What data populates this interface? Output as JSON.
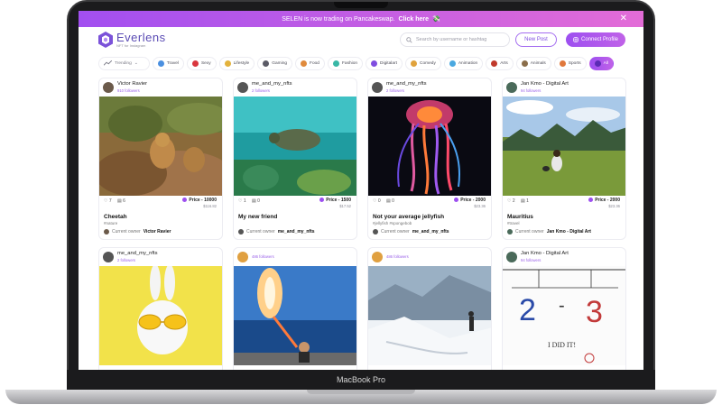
{
  "banner": {
    "text": "SELEN is now trading on Pancakeswap.",
    "link": "Click here",
    "emoji": "💸",
    "close_icon": "close-icon"
  },
  "brand": {
    "name": "Everlens",
    "tagline": "NFT for Instagram"
  },
  "header": {
    "search_placeholder": "Search by username or hashtag",
    "new_post_label": "New Post",
    "connect_label": "Connect Profile"
  },
  "categories": [
    {
      "label": "Trending",
      "icon": "trending-icon",
      "color": "#7b7b87"
    },
    {
      "label": "Travel",
      "icon": "plane-icon",
      "color": "#4a8fe0"
    },
    {
      "label": "Sexy",
      "icon": "lips-icon",
      "color": "#d9363e"
    },
    {
      "label": "Lifestyle",
      "icon": "sparkle-icon",
      "color": "#e3b23c"
    },
    {
      "label": "Gaming",
      "icon": "joystick-icon",
      "color": "#5a5a66"
    },
    {
      "label": "Food",
      "icon": "food-icon",
      "color": "#e08a3c"
    },
    {
      "label": "Fashion",
      "icon": "dress-icon",
      "color": "#38b7a6"
    },
    {
      "label": "Digitalart",
      "icon": "palette-icon",
      "color": "#7f4de0"
    },
    {
      "label": "Comedy",
      "icon": "laugh-icon",
      "color": "#e0a23c"
    },
    {
      "label": "Animation",
      "icon": "film-icon",
      "color": "#4aa8e0"
    },
    {
      "label": "Arts",
      "icon": "brush-icon",
      "color": "#c0392b"
    },
    {
      "label": "Animals",
      "icon": "paw-icon",
      "color": "#8a6d4a"
    },
    {
      "label": "Sports",
      "icon": "ball-icon",
      "color": "#e0783c"
    },
    {
      "label": "All",
      "icon": "all-icon",
      "color": "#9d4ff0"
    }
  ],
  "cards": [
    {
      "user": "Victor Ravier",
      "followers": "910 followers",
      "likes": "7",
      "views": "6",
      "price": "Price - 10000",
      "usd": "$116.82",
      "title": "Cheetah",
      "tag": "#nature",
      "owner_prefix": "Current owner",
      "owner": "Victor Ravier",
      "image": "cheetah-photo"
    },
    {
      "user": "me_and_my_nfts",
      "followers": "2 followers",
      "likes": "1",
      "views": "0",
      "price": "Price - 1500",
      "usd": "$17.52",
      "title": "My new friend",
      "tag": "",
      "owner_prefix": "Current owner",
      "owner": "me_and_my_nfts",
      "image": "turtle-photo"
    },
    {
      "user": "me_and_my_nfts",
      "followers": "2 followers",
      "likes": "0",
      "views": "0",
      "price": "Price - 2000",
      "usd": "$23.36",
      "title": "Not your average jellyfish",
      "tag": "#jellyfish #spongebob",
      "owner_prefix": "Current owner",
      "owner": "me_and_my_nfts",
      "image": "jellyfish-photo"
    },
    {
      "user": "Jan Kmo - Digital Art",
      "followers": "94 followers",
      "likes": "2",
      "views": "1",
      "price": "Price - 2000",
      "usd": "$23.36",
      "title": "Mauritius",
      "tag": "#travel",
      "owner_prefix": "Current owner",
      "owner": "Jan Kmo - Digital Art",
      "image": "mauritius-photo"
    },
    {
      "user": "me_and_my_nfts",
      "followers": "2 followers",
      "image": "bunny-photo"
    },
    {
      "user": "",
      "followers": "486 followers",
      "image": "flare-photo"
    },
    {
      "user": "",
      "followers": "486 followers",
      "image": "snow-photo"
    },
    {
      "user": "Jan Kmo - Digital Art",
      "followers": "94 followers",
      "image": "drawing-photo",
      "drawing_text": "I DID IT!"
    }
  ],
  "device": {
    "label": "MacBook Pro"
  }
}
